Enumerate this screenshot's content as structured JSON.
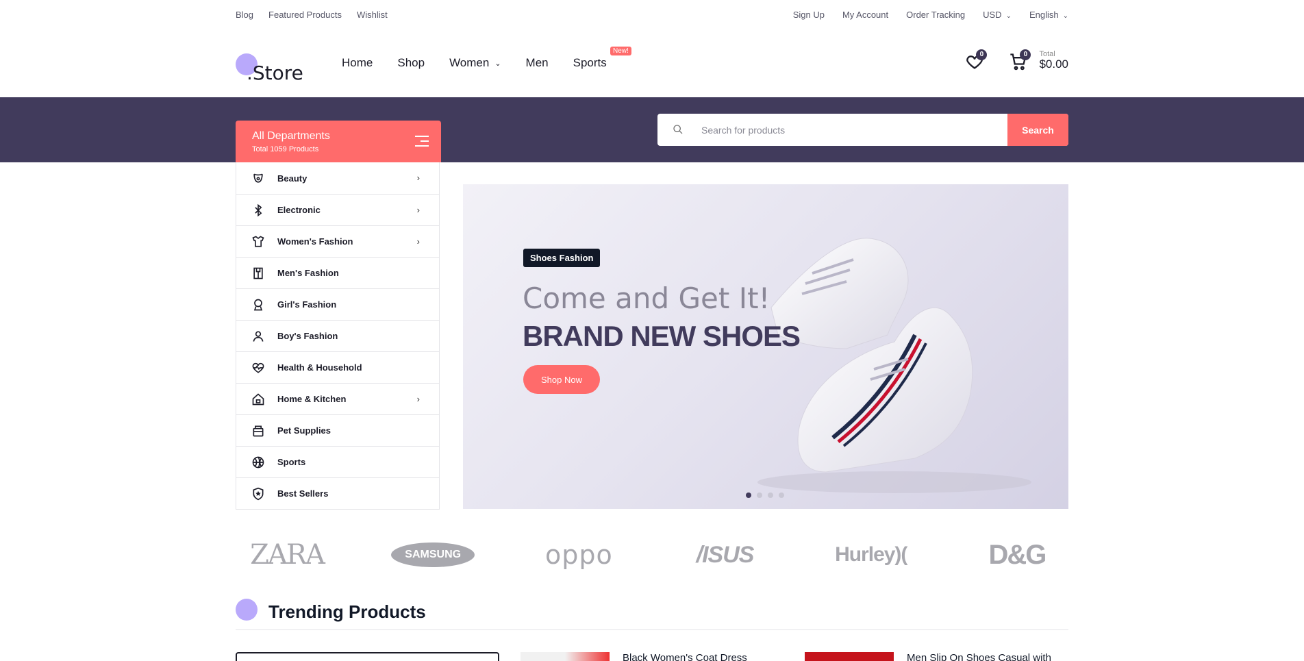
{
  "topbar": {
    "left_links": [
      "Blog",
      "Featured Products",
      "Wishlist"
    ],
    "sign_up": "Sign Up",
    "my_account": "My Account",
    "order_tracking": "Order Tracking",
    "currency": "USD",
    "language": "English"
  },
  "header": {
    "logo": ".Store",
    "nav": {
      "home": "Home",
      "shop": "Shop",
      "women": "Women",
      "men": "Men",
      "sports": "Sports",
      "sports_badge": "New!"
    },
    "wishlist_count": "0",
    "cart_count": "0",
    "total_label": "Total",
    "total_value": "$0.00"
  },
  "departments": {
    "title": "All Departments",
    "subtitle": "Total 1059 Products",
    "items": [
      {
        "label": "Beauty",
        "icon": "beauty-icon"
      },
      {
        "label": "Electronic",
        "icon": "bluetooth-icon"
      },
      {
        "label": "Women's Fashion",
        "icon": "dress-icon"
      },
      {
        "label": "Men's Fashion",
        "icon": "shirt-icon"
      },
      {
        "label": "Girl's Fashion",
        "icon": "girl-icon"
      },
      {
        "label": "Boy's Fashion",
        "icon": "boy-icon"
      },
      {
        "label": "Health & Household",
        "icon": "heartbeat-icon"
      },
      {
        "label": "Home & Kitchen",
        "icon": "home-icon"
      },
      {
        "label": "Pet Supplies",
        "icon": "pet-icon"
      },
      {
        "label": "Sports",
        "icon": "basketball-icon"
      },
      {
        "label": "Best Sellers",
        "icon": "badge-star-icon"
      }
    ]
  },
  "search": {
    "placeholder": "Search for products",
    "button": "Search"
  },
  "hero": {
    "tag": "Shoes Fashion",
    "headline": "Come and Get It!",
    "subheadline": "BRAND NEW SHOES",
    "button": "Shop Now",
    "slides": 4,
    "active_slide": 1
  },
  "brands": [
    "ZARA",
    "SAMSUNG",
    "oppo",
    "/ISUS",
    "Hurley)(",
    "D&G"
  ],
  "trending": {
    "title": "Trending Products",
    "products": [
      "Black Women's Coat Dress",
      "Men Slip On Shoes Casual with"
    ]
  },
  "colors": {
    "accent": "#ff6b6b",
    "band": "#413b5c",
    "logo_dot": "#b9a9fb"
  }
}
